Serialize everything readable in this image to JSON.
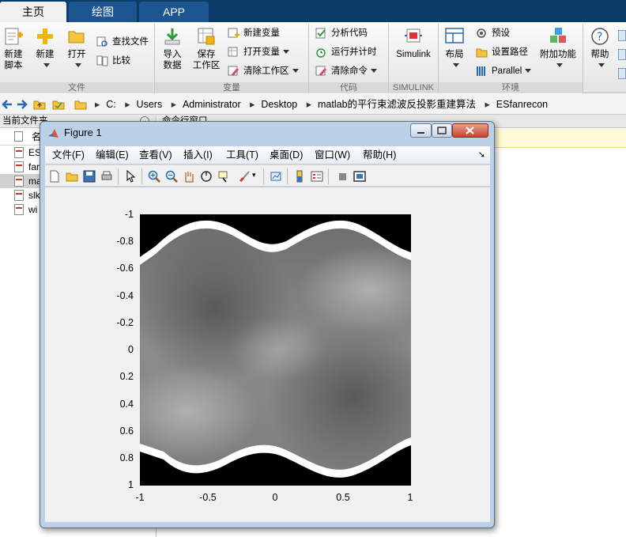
{
  "ribbon_tabs": [
    {
      "label": "主页",
      "active": true
    },
    {
      "label": "绘图",
      "active": false
    },
    {
      "label": "APP",
      "active": false
    }
  ],
  "ribbon": {
    "groups": {
      "file": "文件",
      "variable": "变量",
      "code": "代码",
      "simulink": "SIMULINK",
      "environment": "环境"
    },
    "new_script": {
      "line1": "新建",
      "line2": "脚本"
    },
    "new": "新建",
    "open": "打开",
    "find_files": "查找文件",
    "compare": "比较",
    "import_data": {
      "line1": "导入",
      "line2": "数据"
    },
    "save_workspace": {
      "line1": "保存",
      "line2": "工作区"
    },
    "new_variable": "新建变量",
    "open_variable": "打开变量",
    "clear_workspace": "清除工作区",
    "analyze_code": "分析代码",
    "run_and_time": "运行并计时",
    "clear_commands": "清除命令",
    "simulink": "Simulink",
    "layout": "布局",
    "preferences": "预设",
    "set_path": "设置路径",
    "parallel": "Parallel",
    "addons": "附加功能",
    "help": "帮助"
  },
  "address_bar": {
    "crumbs": [
      "C:",
      "Users",
      "Administrator",
      "Desktop",
      "matlab的平行束滤波反投影重建算法",
      "ESfanrecon"
    ]
  },
  "current_folder": {
    "title": "当前文件夹",
    "column_header": "名",
    "files": [
      {
        "name": "ES",
        "selected": false
      },
      {
        "name": "far",
        "selected": false
      },
      {
        "name": "ma",
        "selected": true
      },
      {
        "name": "slk",
        "selected": false
      },
      {
        "name": "wi",
        "selected": false
      }
    ]
  },
  "command_window": {
    "title": "命令行窗口"
  },
  "figure": {
    "title": "Figure 1",
    "menus": [
      "文件(F)",
      "编辑(E)",
      "查看(V)",
      "插入(I)",
      "工具(T)",
      "桌面(D)",
      "窗口(W)",
      "帮助(H)"
    ],
    "colormap": "gray",
    "yticks": [
      "-1",
      "-0.8",
      "-0.6",
      "-0.4",
      "-0.2",
      "0",
      "0.2",
      "0.4",
      "0.6",
      "0.8",
      "1"
    ],
    "xticks": [
      "-1",
      "-0.5",
      "0",
      "0.5",
      "1"
    ]
  }
}
